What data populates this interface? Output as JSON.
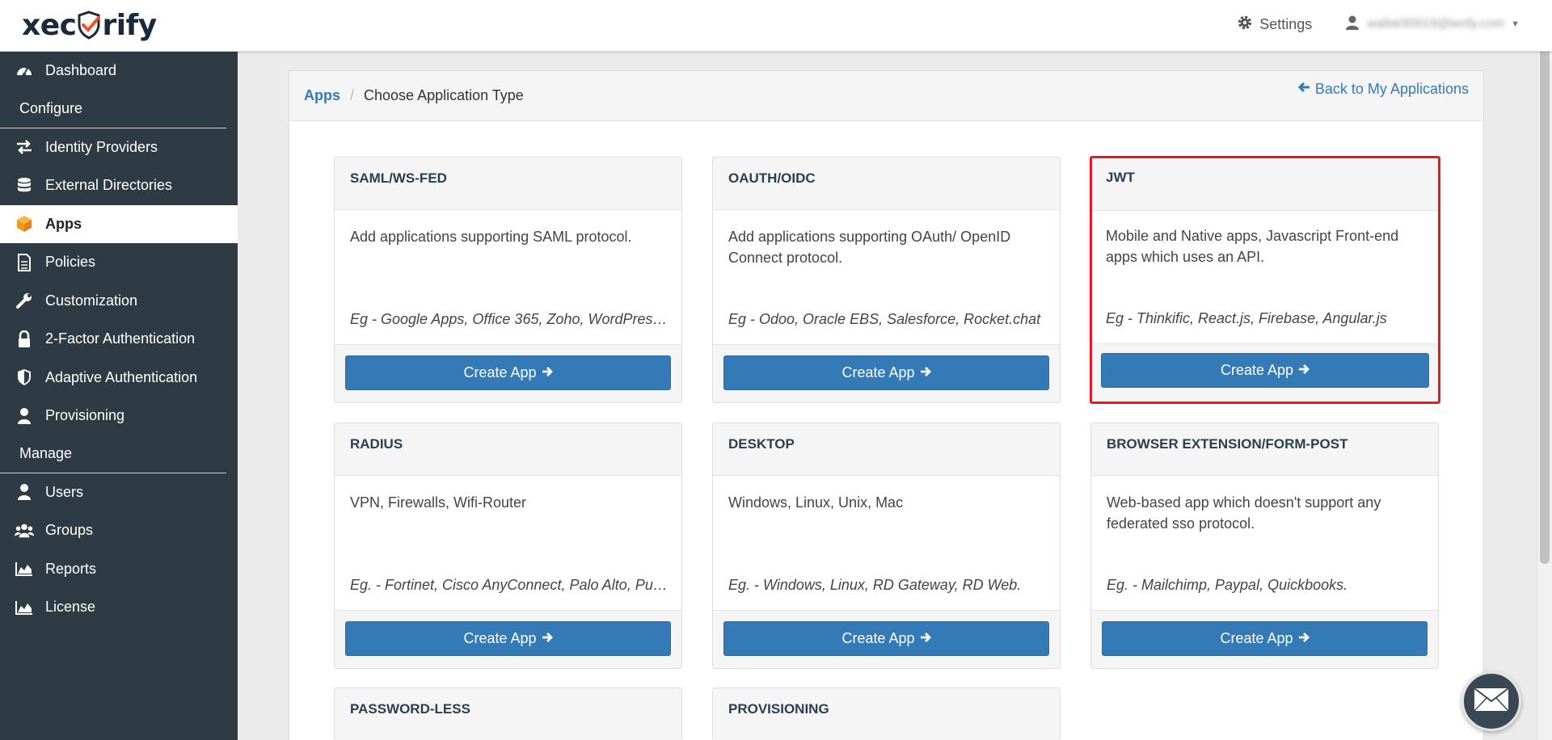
{
  "brand": {
    "logo_text_left": "xec",
    "logo_text_right": "rify",
    "shield_color": "#e8542f"
  },
  "topbar": {
    "settings_label": "Settings",
    "user_email": "wafek90919@lenfy.com"
  },
  "sidebar": {
    "items": [
      {
        "label": "Dashboard",
        "icon": "dashboard-icon"
      },
      {
        "section": "Configure"
      },
      {
        "label": "Identity Providers",
        "icon": "exchange-icon"
      },
      {
        "label": "External Directories",
        "icon": "database-icon"
      },
      {
        "label": "Apps",
        "icon": "cube-icon",
        "active": true
      },
      {
        "label": "Policies",
        "icon": "file-icon"
      },
      {
        "label": "Customization",
        "icon": "wrench-icon"
      },
      {
        "label": "2-Factor Authentication",
        "icon": "lock-icon"
      },
      {
        "label": "Adaptive Authentication",
        "icon": "shield-icon"
      },
      {
        "label": "Provisioning",
        "icon": "user-icon"
      },
      {
        "section": "Manage"
      },
      {
        "label": "Users",
        "icon": "user-icon"
      },
      {
        "label": "Groups",
        "icon": "users-icon"
      },
      {
        "label": "Reports",
        "icon": "area-chart-icon"
      },
      {
        "label": "License",
        "icon": "area-chart-icon"
      }
    ]
  },
  "breadcrumb": {
    "root": "Apps",
    "separator": "/",
    "current": "Choose Application Type"
  },
  "back_link": "Back to My Applications",
  "cards": [
    {
      "title": "SAML/WS-FED",
      "desc": "Add applications supporting SAML protocol.",
      "eg": "Eg - Google Apps, Office 365, Zoho, WordPress…",
      "button": "Create App"
    },
    {
      "title": "OAUTH/OIDC",
      "desc": "Add applications supporting OAuth/ OpenID Connect protocol.",
      "eg": "Eg - Odoo, Oracle EBS, Salesforce, Rocket.chat",
      "button": "Create App"
    },
    {
      "title": "JWT",
      "desc": "Mobile and Native apps, Javascript Front-end apps which uses an API.",
      "eg": "Eg - Thinkific, React.js, Firebase, Angular.js",
      "button": "Create App",
      "highlighted": true
    },
    {
      "title": "RADIUS",
      "desc": "VPN, Firewalls, Wifi-Router",
      "eg": "Eg. - Fortinet, Cisco AnyConnect, Palo Alto, Pul…",
      "button": "Create App"
    },
    {
      "title": "DESKTOP",
      "desc": "Windows, Linux, Unix, Mac",
      "eg": "Eg. - Windows, Linux, RD Gateway, RD Web.",
      "button": "Create App"
    },
    {
      "title": "BROWSER EXTENSION/FORM-POST",
      "desc": "Web-based app which doesn't support any federated sso protocol.",
      "eg": "Eg. - Mailchimp, Paypal, Quickbooks.",
      "button": "Create App"
    },
    {
      "title": "PASSWORD-LESS"
    },
    {
      "title": "PROVISIONING"
    }
  ],
  "colors": {
    "sidebar_bg": "#2f3b44",
    "primary": "#337ab7",
    "highlight": "#e01b24",
    "apps_icon": "#f39c12"
  }
}
